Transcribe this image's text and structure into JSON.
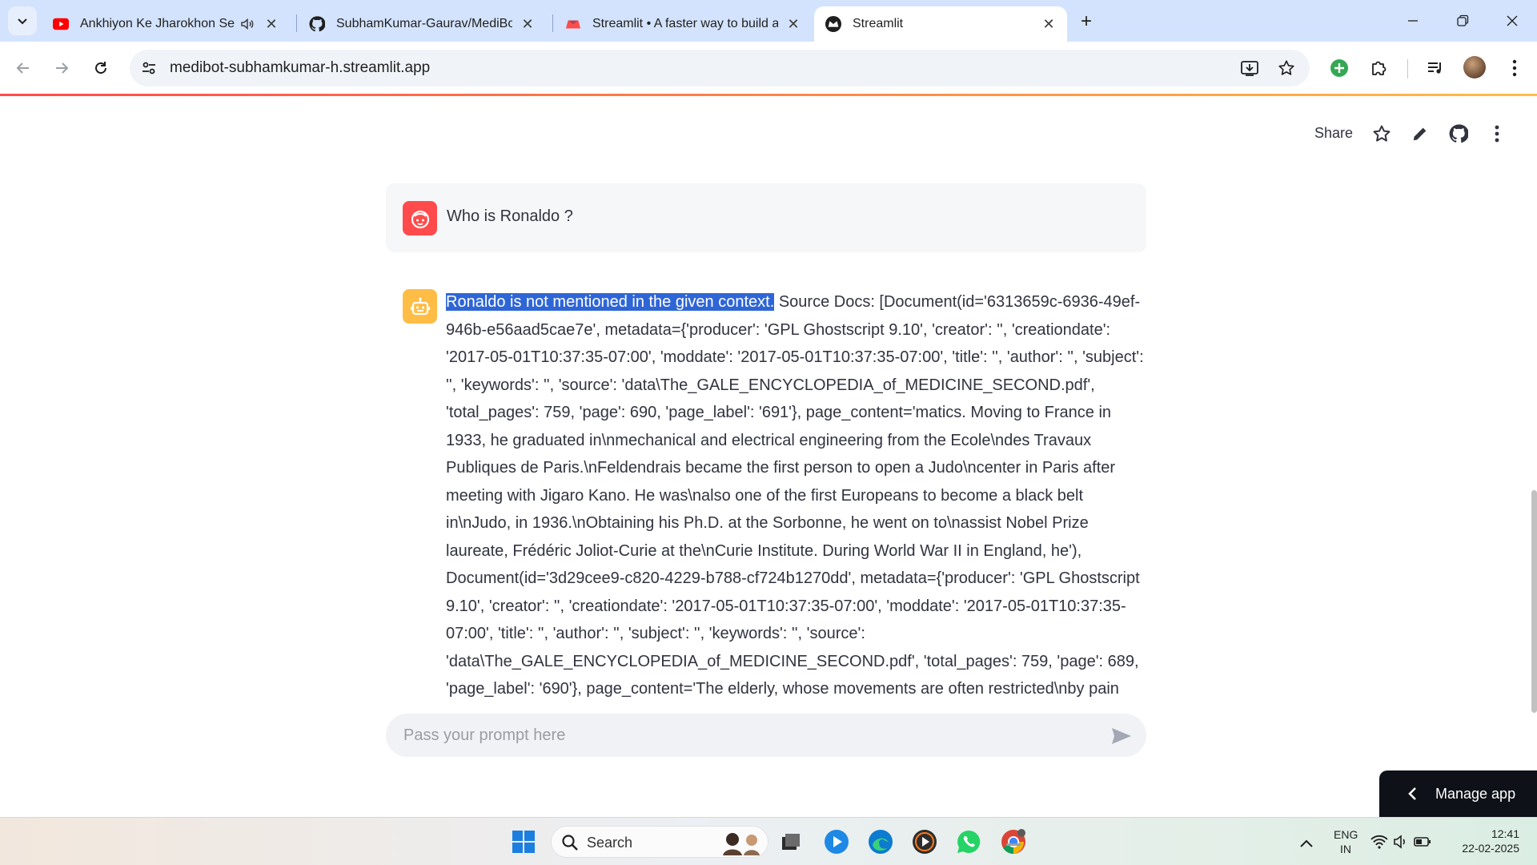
{
  "browser": {
    "tabs": [
      {
        "title": "Ankhiyon Ke Jharokhon Se Titl",
        "icon": "youtube-icon",
        "audio": true,
        "active": false
      },
      {
        "title": "SubhamKumar-Gaurav/MediBot",
        "icon": "github-icon",
        "active": false
      },
      {
        "title": "Streamlit • A faster way to build ar",
        "icon": "streamlit-icon",
        "active": false
      },
      {
        "title": "Streamlit",
        "icon": "streamlit-icon",
        "active": true
      }
    ],
    "url": "medibot-subhamkumar-h.streamlit.app"
  },
  "header": {
    "share_label": "Share"
  },
  "chat": {
    "user_message": "Who is Ronaldo ?",
    "bot_highlight": "Ronaldo is not mentioned in the given context.",
    "bot_message": " Source Docs: [Document(id='6313659c-6936-49ef-946b-e56aad5cae7e', metadata={'producer': 'GPL Ghostscript 9.10', 'creator': '', 'creationdate': '2017-05-01T10:37:35-07:00', 'moddate': '2017-05-01T10:37:35-07:00', 'title': '', 'author': '', 'subject': '', 'keywords': '', 'source': 'data\\The_GALE_ENCYCLOPEDIA_of_MEDICINE_SECOND.pdf', 'total_pages': 759, 'page': 690, 'page_label': '691'}, page_content='matics. Moving to France in 1933, he graduated in\\nmechanical and electrical engineering from the Ecole\\ndes Travaux Publiques de Paris.\\nFeldendrais became the first person to open a Judo\\ncenter in Paris after meeting with Jigaro Kano. He was\\nalso one of the first Europeans to become a black belt in\\nJudo, in 1936.\\nObtaining his Ph.D. at the Sorbonne, he went on to\\nassist Nobel Prize laureate, Frédéric Joliot-Curie at the\\nCurie Institute. During World War II in England, he'), Document(id='3d29cee9-c820-4229-b788-cf724b1270dd', metadata={'producer': 'GPL Ghostscript 9.10', 'creator': '', 'creationdate': '2017-05-01T10:37:35-07:00', 'moddate': '2017-05-01T10:37:35-07:00', 'title': '', 'author': '', 'subject': '', 'keywords': '', 'source': 'data\\The_GALE_ENCYCLOPEDIA_of_MEDICINE_SECOND.pdf', 'total_pages': 759, 'page': 689, 'page_label': '690'}, page_content='The elderly, whose movements are often restricted\\nby pain",
    "input_placeholder": "Pass your prompt here"
  },
  "manage_app_label": "Manage app",
  "taskbar": {
    "search_label": "Search",
    "language": "ENG",
    "region": "IN",
    "time": "12:41",
    "date": "22-02-2025"
  },
  "colors": {
    "user_avatar": "#ff4b4b",
    "bot_avatar": "#ffbd45",
    "highlight": "#2f66d6",
    "tabstrip": "#d3e3fd"
  }
}
